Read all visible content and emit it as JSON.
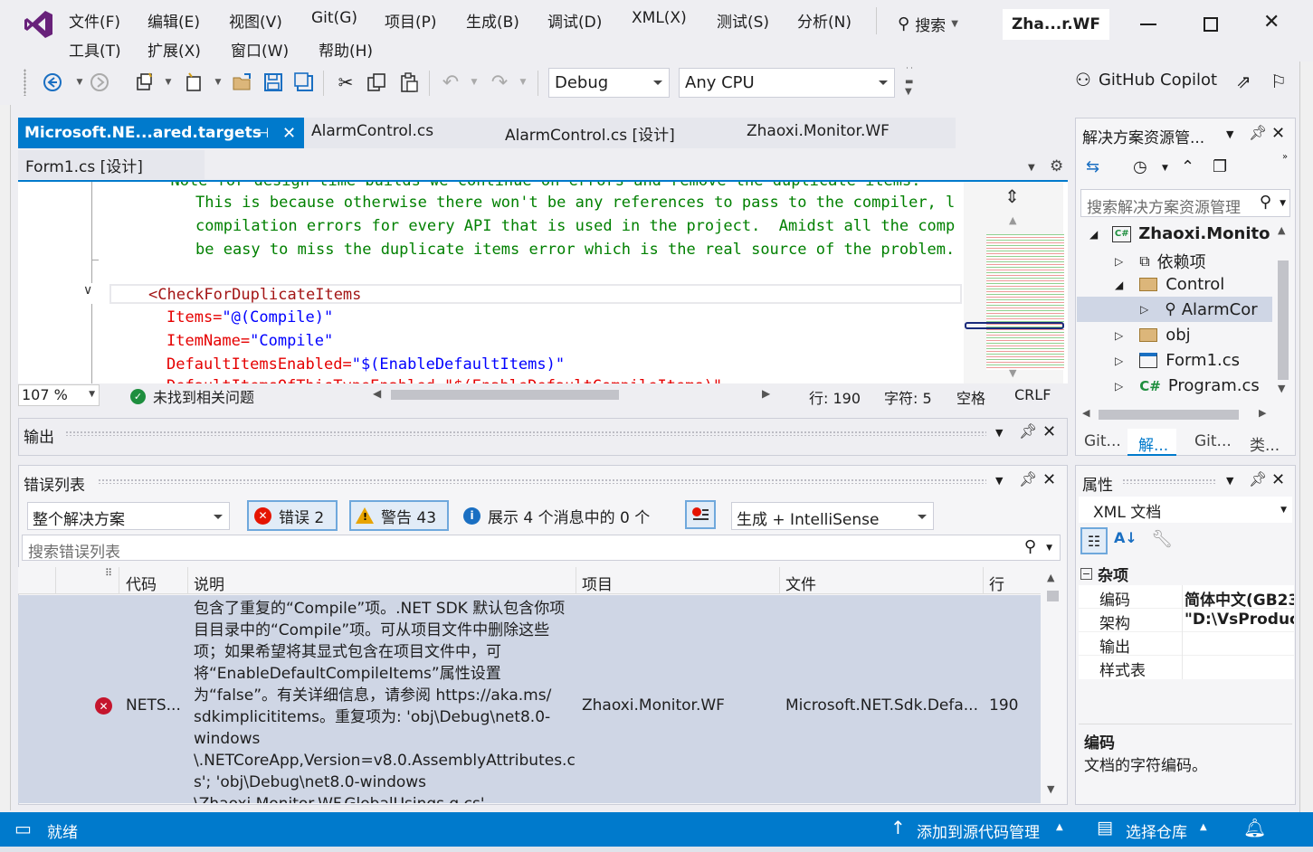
{
  "menu": {
    "row1": [
      "文件(F)",
      "编辑(E)",
      "视图(V)",
      "Git(G)",
      "项目(P)",
      "生成(B)",
      "调试(D)",
      "XML(X)",
      "测试(S)",
      "分析(N)"
    ],
    "row2": [
      "工具(T)",
      "扩展(X)",
      "窗口(W)",
      "帮助(H)"
    ],
    "search_label": "搜索",
    "window_title": "Zha...r.WF"
  },
  "toolbar": {
    "config": "Debug",
    "platform": "Any CPU",
    "copilot": "GitHub Copilot"
  },
  "editor": {
    "tabs": [
      "Microsoft.NE...ared.targets",
      "AlarmControl.cs",
      "AlarmControl.cs [设计]",
      "Zhaoxi.Monitor.WF"
    ],
    "tab_row2": "Form1.cs [设计]",
    "lines": {
      "l0": "  Note for design-time builds we continue on errors and remove the duplicate items.",
      "l1": "This is because otherwise there won't be any references to pass to the compiler, l",
      "l2": "compilation errors for every API that is used in the project.  Amidst all the comp",
      "l3": "be easy to miss the duplicate items error which is the real source of the problem.",
      "tag_open": "<CheckForDuplicateItems",
      "a1_name": "Items=",
      "a1_val": "\"@(Compile)\"",
      "a2_name": "ItemName=",
      "a2_val": "\"Compile\"",
      "a3_name": "DefaultItemsEnabled=",
      "a3_val": "\"$(EnableDefaultItems)\"",
      "l8": "DefaultItemsOfThisTypeEnabled=\"$(EnableDefaultCompileItems)\""
    },
    "zoom": "107 %",
    "issues": "未找到相关问题",
    "line": "行: 190",
    "char": "字符: 5",
    "space": "空格",
    "eol": "CRLF"
  },
  "output": {
    "title": "输出"
  },
  "errorlist": {
    "title": "错误列表",
    "scope": "整个解决方案",
    "errors": "错误 2",
    "warnings": "警告 43",
    "messages": "展示 4 个消息中的 0 个",
    "source": "生成 + IntelliSense",
    "search_placeholder": "搜索错误列表",
    "headers": [
      "代码",
      "说明",
      "项目",
      "文件",
      "行"
    ],
    "row": {
      "code": "NETS...",
      "desc": [
        "包含了重复的“Compile”项。.NET SDK 默认包含你项",
        "目目录中的“Compile”项。可从项目文件中删除这些",
        "项；如果希望将其显式包含在项目文件中，可",
        "将“EnableDefaultCompileItems”属性设置",
        "为“false”。有关详细信息，请参阅 https://aka.ms/",
        "sdkimplicititems。重复项为: 'obj\\Debug\\net8.0-",
        "windows",
        "\\.NETCoreApp,Version=v8.0.AssemblyAttributes.c",
        "s'; 'obj\\Debug\\net8.0-windows",
        "\\Zhaoxi.Monitor.WF.GlobalUsings.g.cs'"
      ],
      "project": "Zhaoxi.Monitor.WF",
      "file": "Microsoft.NET.Sdk.Defa...",
      "line": "190"
    }
  },
  "solution": {
    "title": "解决方案资源管...",
    "search_placeholder": "搜索解决方案资源管理",
    "items": [
      "Zhaoxi.Monito",
      "依赖项",
      "Control",
      "AlarmCor",
      "obj",
      "Form1.cs",
      "Program.cs"
    ],
    "bottom_tabs": [
      "Git...",
      "解...",
      "Git...",
      "类..."
    ]
  },
  "properties": {
    "title": "属性",
    "object": "XML 文档",
    "category": "杂项",
    "rows": [
      {
        "name": "编码",
        "value": "简体中文(GB23"
      },
      {
        "name": "架构",
        "value": "\"D:\\VsProduc"
      },
      {
        "name": "输出",
        "value": ""
      },
      {
        "name": "样式表",
        "value": ""
      }
    ],
    "desc_title": "编码",
    "desc_text": "文档的字符编码。"
  },
  "statusbar": {
    "ready": "就绪",
    "add_source": "添加到源代码管理",
    "select_repo": "选择仓库"
  },
  "colors": {
    "accent": "#007acc",
    "purple": "#68217a",
    "selected_row": "#cfd6e5",
    "status": "#007acc"
  }
}
